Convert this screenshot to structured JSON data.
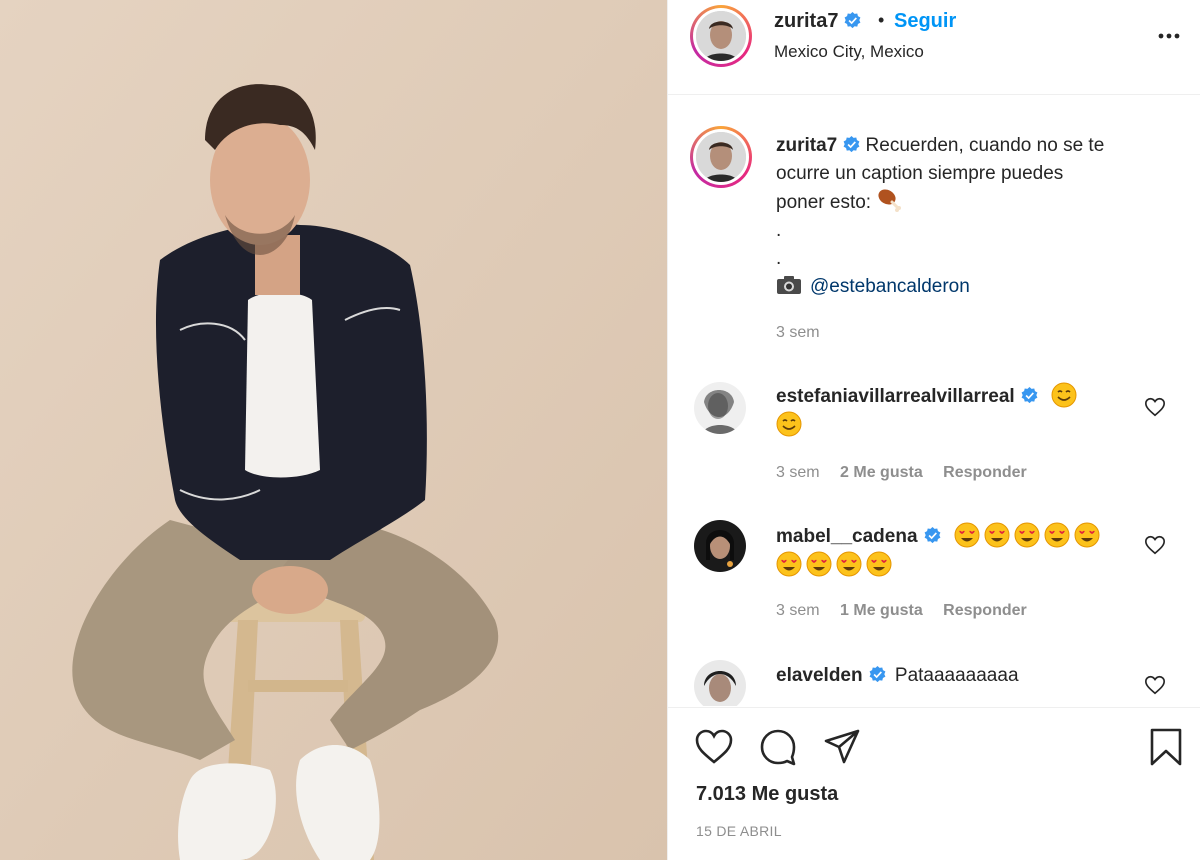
{
  "post": {
    "username": "zurita7",
    "follow_label": "Seguir",
    "separator": "•",
    "location": "Mexico City, Mexico"
  },
  "caption": {
    "username": "zurita7",
    "text_line1": "Recuerden, cuando no se te",
    "text_line2": "ocurre un caption siempre puedes",
    "text_line3": "poner esto:",
    "dot1": ".",
    "dot2": ".",
    "mention": "@estebancalderon",
    "time": "3 sem"
  },
  "comments": [
    {
      "username": "estefaniavillarrealvillarreal",
      "time": "3 sem",
      "likes": "2 Me gusta",
      "reply": "Responder"
    },
    {
      "username": "mabel__cadena",
      "time": "3 sem",
      "likes": "1 Me gusta",
      "reply": "Responder"
    },
    {
      "username": "elavelden",
      "text": "Pataaaaaaaaa"
    }
  ],
  "footer": {
    "likes": "7.013 Me gusta",
    "date": "15 DE ABRIL"
  },
  "icons": [
    "verified-icon",
    "more-options-icon",
    "drumstick-icon",
    "camera-icon",
    "smile-icon",
    "heart-eyes-icon",
    "heart-outline-icon",
    "comment-icon",
    "share-icon",
    "save-icon"
  ],
  "colors": {
    "link_blue": "#0095f6",
    "mention_blue": "#00376b",
    "verified_blue": "#3897f0",
    "muted_gray": "#8e8e8e",
    "photo_background": "#e0cdb9"
  }
}
